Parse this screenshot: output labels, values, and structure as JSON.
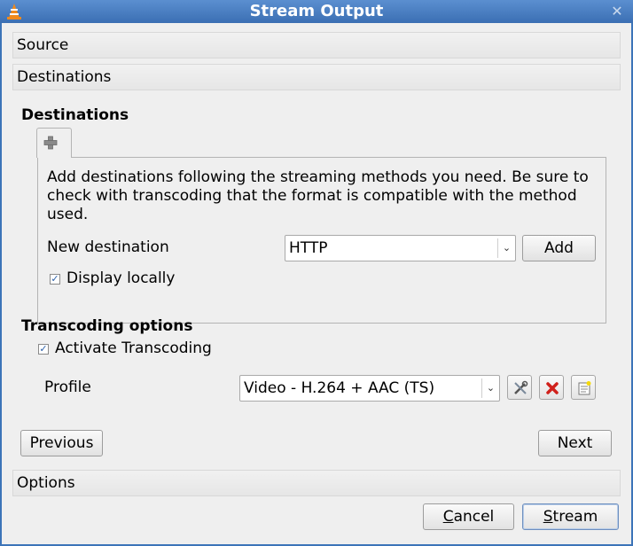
{
  "window": {
    "title": "Stream Output"
  },
  "sections": {
    "source": "Source",
    "destinations": "Destinations",
    "options": "Options"
  },
  "destinations": {
    "group_title": "Destinations",
    "tab_icon": "plus-icon",
    "description": "Add destinations following the streaming methods you need. Be sure to check with transcoding that the format is compatible with the method used.",
    "new_destination_label": "New destination",
    "method_selected": "HTTP",
    "add_label": "Add",
    "display_locally_label": "Display locally",
    "display_locally_checked": true
  },
  "transcoding": {
    "group_title": "Transcoding options",
    "activate_label": "Activate Transcoding",
    "activate_checked": true,
    "profile_label": "Profile",
    "profile_selected": "Video - H.264 + AAC (TS)",
    "icons": [
      "edit-profile-icon",
      "delete-profile-icon",
      "new-profile-icon"
    ]
  },
  "nav": {
    "previous_label": "Previous",
    "next_label": "Next"
  },
  "footer": {
    "cancel_first": "C",
    "cancel_rest": "ancel",
    "stream_first": "S",
    "stream_rest": "tream"
  },
  "colors": {
    "titlebar": "#3b6fb3",
    "accent": "#2a5fa8",
    "delete_red": "#d0201b"
  }
}
